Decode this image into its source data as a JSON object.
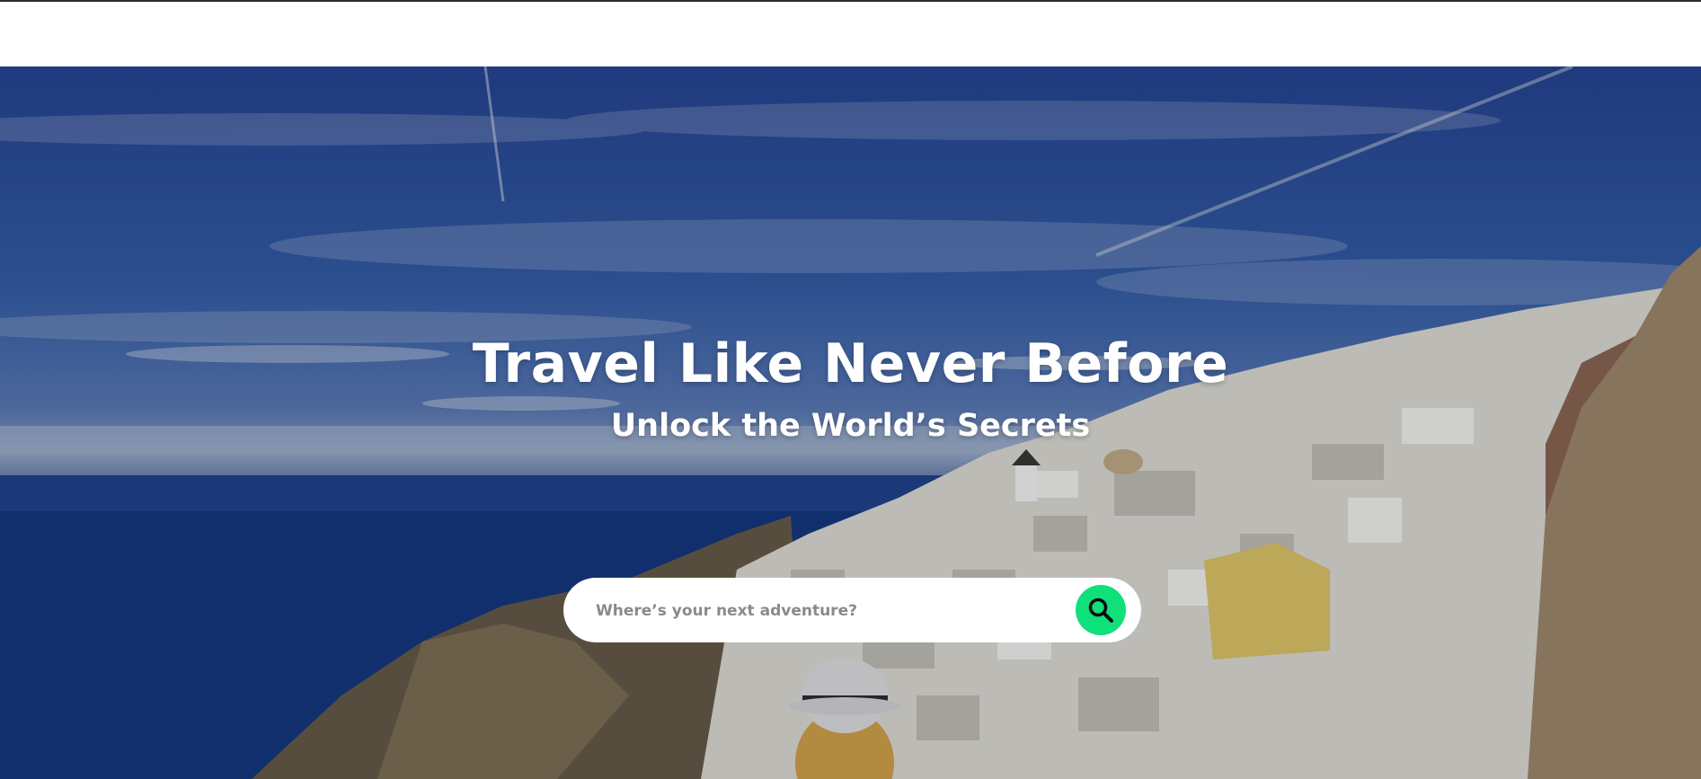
{
  "hero": {
    "title": "Travel Like Never Before",
    "subtitle": "Unlock the World’s Secrets"
  },
  "search": {
    "placeholder": "Where’s your next adventure?",
    "value": "",
    "button_icon": "search-icon"
  },
  "colors": {
    "accent": "#0fe07a",
    "hero_text": "#ffffff",
    "search_bg": "#ffffff"
  }
}
